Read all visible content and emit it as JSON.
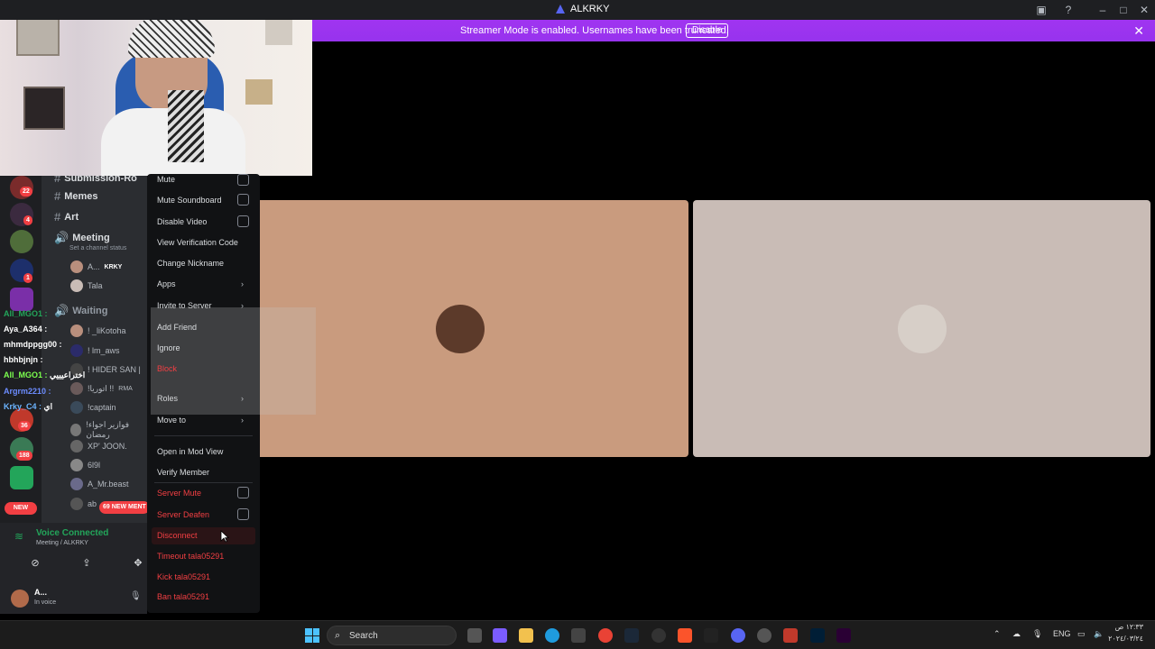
{
  "window": {
    "title": "ALKRKY"
  },
  "banner": {
    "text": "Streamer Mode is enabled. Usernames have been truncated.",
    "disable_label": "Disable"
  },
  "sidebar": {
    "guild_badges": [
      "22",
      "4",
      "1",
      "36",
      "188"
    ],
    "channels": [
      {
        "name": "Submission-Ro",
        "type": "text"
      },
      {
        "name": "Memes",
        "type": "text"
      },
      {
        "name": "Art",
        "type": "text"
      },
      {
        "name": "Meeting",
        "type": "voice",
        "status": "Set a channel status"
      },
      {
        "name": "Waiting",
        "type": "voice"
      }
    ],
    "meeting_members": [
      {
        "name": "A...",
        "tag": "KRKY"
      },
      {
        "name": "Tala"
      }
    ],
    "waiting_members": [
      {
        "name": "! _liKotoha"
      },
      {
        "name": "! lm_aws"
      },
      {
        "name": "! HIDER SAN |"
      },
      {
        "name": "!اتوريا !!",
        "tag": "RMA"
      },
      {
        "name": "!captain"
      },
      {
        "name": "!فوازير اجواء رمضان"
      },
      {
        "name": "XP' JOON."
      },
      {
        "name": "6l9l"
      },
      {
        "name": "A_Mr.beast"
      },
      {
        "name": "ab"
      }
    ],
    "chat_overlay": [
      {
        "user": "All_MGO1 :",
        "msg": "",
        "color": "#23a55a"
      },
      {
        "user": "Aya_A364 :",
        "msg": "",
        "color": "#ffffff"
      },
      {
        "user": "mhmdppgg00 :",
        "msg": "",
        "color": "#ffffff"
      },
      {
        "user": "hbhbjnjn :",
        "msg": "",
        "color": "#ffffff"
      },
      {
        "user": "All_MGO1 :",
        "msg": "اختراعيييي",
        "color": "#7cff4f"
      },
      {
        "user": "Argrm2210 :",
        "msg": "",
        "color": "#6c8cff"
      },
      {
        "user": "Krky_C4 :",
        "msg": "اي",
        "color": "#6cb4ff"
      }
    ],
    "new_label": "NEW",
    "mentions_label": "69 NEW MENT",
    "voice": {
      "status": "Voice Connected",
      "channel": "Meeting / ALKRKY"
    },
    "user": {
      "name": "A...",
      "status": "In voice"
    }
  },
  "context_menu": {
    "items": [
      {
        "label": "Mute",
        "kind": "check"
      },
      {
        "label": "Mute Soundboard",
        "kind": "check"
      },
      {
        "label": "Disable Video",
        "kind": "check"
      },
      {
        "label": "View Verification Code",
        "kind": "plain"
      },
      {
        "label": "Change Nickname",
        "kind": "plain"
      },
      {
        "label": "Apps",
        "kind": "submenu"
      },
      {
        "label": "Invite to Server",
        "kind": "submenu"
      },
      {
        "label": "Roles",
        "kind": "submenu"
      },
      {
        "label": "Move to",
        "kind": "submenu"
      },
      {
        "label": "Open in Mod View",
        "kind": "plain"
      },
      {
        "label": "Verify Member",
        "kind": "plain"
      },
      {
        "label": "Server Mute",
        "kind": "check-danger"
      },
      {
        "label": "Server Deafen",
        "kind": "check-danger"
      },
      {
        "label": "Disconnect",
        "kind": "danger"
      },
      {
        "label": "Timeout tala05291",
        "kind": "danger"
      },
      {
        "label": "Kick tala05291",
        "kind": "danger"
      },
      {
        "label": "Ban tala05291",
        "kind": "danger"
      }
    ],
    "submenu": [
      "Add Friend",
      "Ignore",
      "Block"
    ]
  },
  "stage": {
    "tiles": [
      {
        "bg": "#c99b7e",
        "avatar": "#5c3a2a"
      },
      {
        "bg": "#c9bcb6",
        "avatar": "#d7cfc8"
      }
    ]
  },
  "taskbar": {
    "search_label": "Search",
    "lang": "ENG",
    "time": "١٢:٣٣ ص",
    "date": "٢٠٢٤/٠٣/٢٤"
  },
  "colors": {
    "accent": "#9733ee",
    "danger": "#f23f43",
    "online": "#23a55a"
  }
}
